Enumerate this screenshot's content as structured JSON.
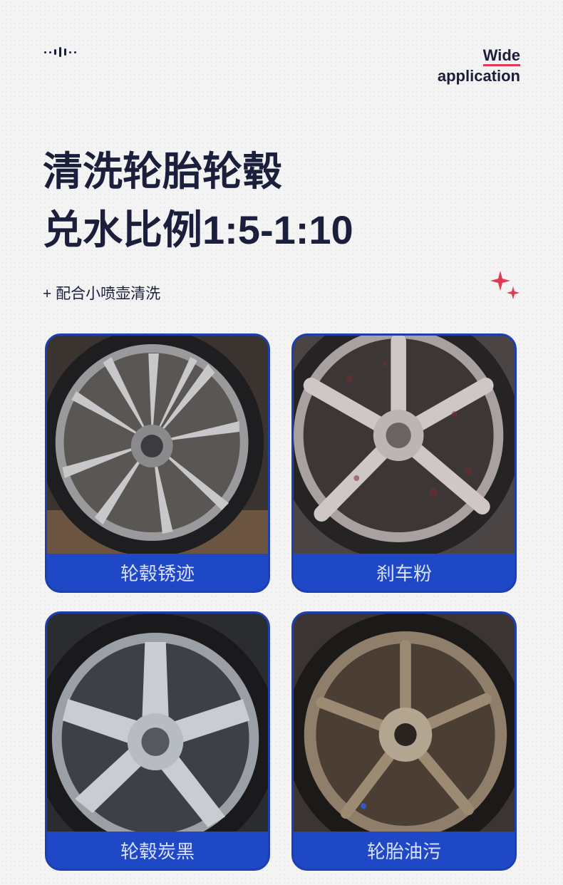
{
  "header": {
    "tagline_line1": "Wide",
    "tagline_line2": "application"
  },
  "headline": {
    "line1": "清洗轮胎轮毂",
    "line2": "兑水比例1:5-1:10"
  },
  "subtitle": "+ 配合小喷壶清洗",
  "colors": {
    "navy": "#1b1f3b",
    "accent_red": "#e03a57",
    "card_blue": "#1f48c7"
  },
  "cards": [
    {
      "label": "轮毂锈迹",
      "icon": "wheel-photo"
    },
    {
      "label": "刹车粉",
      "icon": "wheel-photo"
    },
    {
      "label": "轮毂炭黑",
      "icon": "wheel-photo"
    },
    {
      "label": "轮胎油污",
      "icon": "wheel-photo"
    }
  ]
}
